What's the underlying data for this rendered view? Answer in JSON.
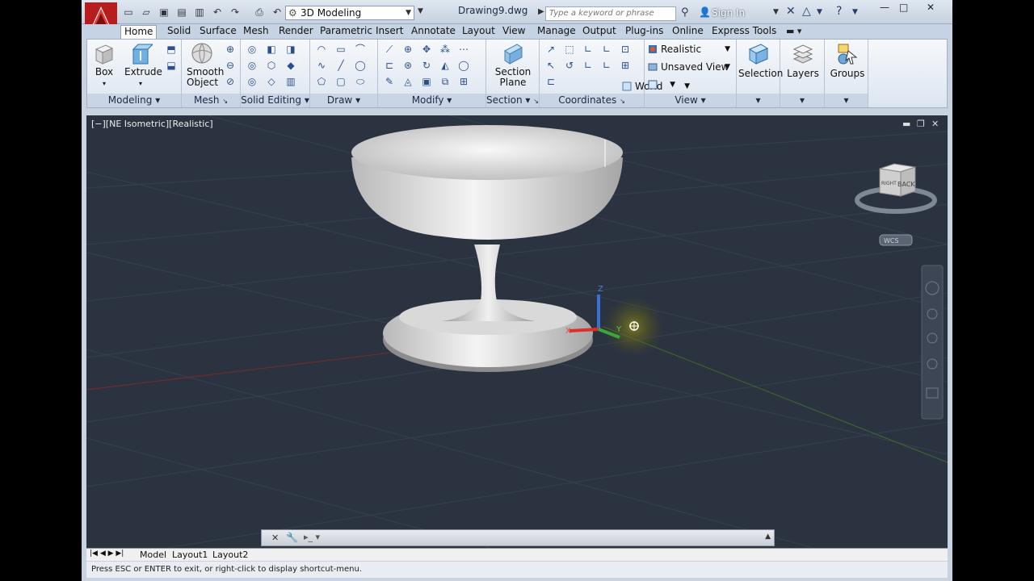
{
  "title": {
    "workspace": "3D Modeling",
    "document": "Drawing9.dwg",
    "search_placeholder": "Type a keyword or phrase",
    "sign_in": "Sign In"
  },
  "tabs": [
    "Home",
    "Solid",
    "Surface",
    "Mesh",
    "Render",
    "Parametric",
    "Insert",
    "Annotate",
    "Layout",
    "View",
    "Manage",
    "Output",
    "Plug-ins",
    "Online",
    "Express Tools"
  ],
  "ribbon": {
    "box": "Box",
    "extrude": "Extrude",
    "smooth_object_1": "Smooth",
    "smooth_object_2": "Object",
    "section_plane_1": "Section",
    "section_plane_2": "Plane",
    "visual_style": "Realistic",
    "named_view": "Unsaved View",
    "ucs": "World",
    "selection": "Selection",
    "layers": "Layers",
    "groups": "Groups",
    "panels": {
      "modeling": "Modeling",
      "mesh": "Mesh",
      "solid_editing": "Solid Editing",
      "draw": "Draw",
      "modify": "Modify",
      "section": "Section",
      "coordinates": "Coordinates",
      "view": "View"
    }
  },
  "viewport": {
    "label": "[−][NE Isometric][Realistic]",
    "viewcube_face": "BACK",
    "viewcube_side": "RIGHT",
    "wcs": "WCS",
    "axis_z": "Z",
    "axis_y": "Y",
    "axis_x": "X"
  },
  "layout_tabs": [
    "Model",
    "Layout1",
    "Layout2"
  ],
  "status": "Press ESC or ENTER to exit, or right-click to display shortcut-menu."
}
